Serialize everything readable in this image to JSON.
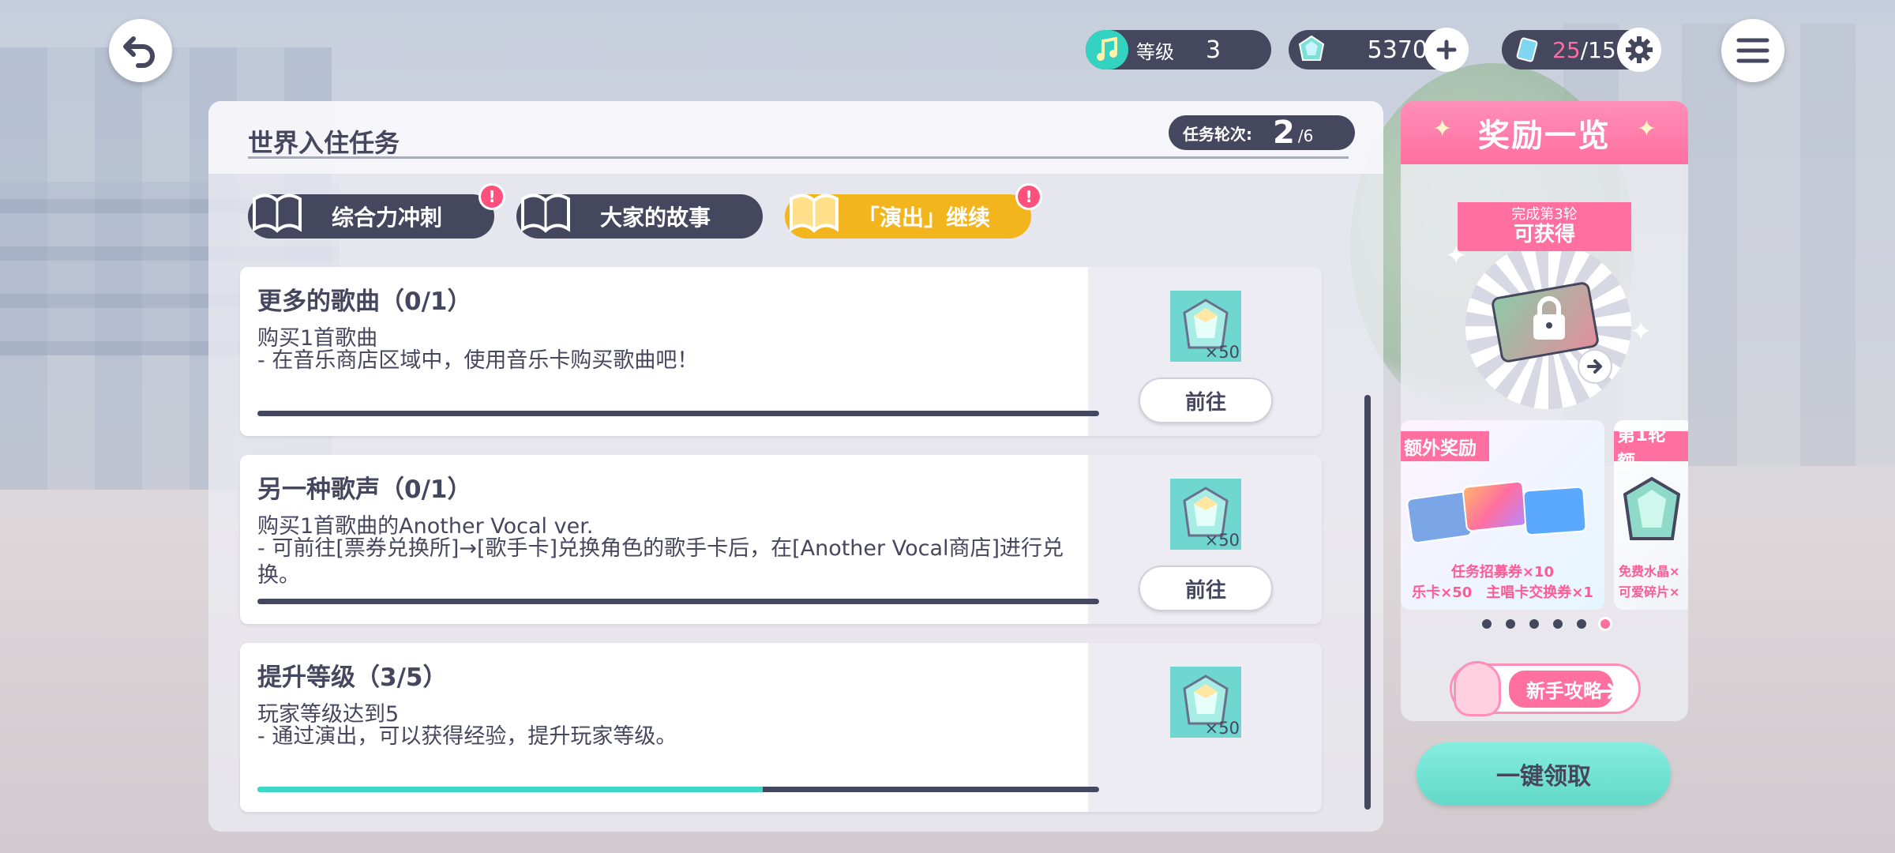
{
  "topbar": {
    "level_label": "等级",
    "level_value": "3",
    "gems": "5370",
    "tickets_current": "25",
    "tickets_max": "/15"
  },
  "panel": {
    "title": "世界入住任务",
    "round_label": "任务轮次:",
    "round_current": "2",
    "round_total": "/6"
  },
  "tabs": [
    {
      "label": "综合力冲刺",
      "alert": "!"
    },
    {
      "label": "大家的故事",
      "alert": ""
    },
    {
      "label": "「演出」继续",
      "alert": "!"
    }
  ],
  "missions": [
    {
      "title": "更多的歌曲（0/1）",
      "desc1": "购买1首歌曲",
      "desc2": "- 在音乐商店区域中，使用音乐卡购买歌曲吧！",
      "progress": 0,
      "reward_qty": "×50",
      "go_label": "前往"
    },
    {
      "title": "另一种歌声（0/1）",
      "desc1": "购买1首歌曲的Another Vocal ver.",
      "desc2": "- 可前往[票券兑换所]→[歌手卡]兑换角色的歌手卡后，在[Another Vocal商店]进行兑换。",
      "progress": 0,
      "reward_qty": "×50",
      "go_label": "前往"
    },
    {
      "title": "提升等级（3/5）",
      "desc1": "玩家等级达到5",
      "desc2": "- 通过演出，可以获得经验，提升玩家等级。",
      "progress": 0.6,
      "reward_qty": "×50",
      "go_label": ""
    }
  ],
  "rewards": {
    "title": "奖励一览",
    "ribbon_small": "完成第3轮",
    "ribbon_big": "可获得",
    "card_a_tag": "额外奖励",
    "card_a_line1": "任务招募券×10",
    "card_a_line2": "乐卡×50　主唱卡交换券×1",
    "card_b_tag": "第1轮额",
    "card_b_line1": "免费水晶×",
    "card_b_line2": "可爱碎片×",
    "page_count": 6,
    "active_page": 6,
    "guide_label": "新手攻略",
    "claim_label": "一键领取"
  },
  "colors": {
    "navy": "#45475e",
    "pink": "#ff6f9f",
    "teal": "#3fd8c6",
    "yellow": "#f2b51e"
  }
}
